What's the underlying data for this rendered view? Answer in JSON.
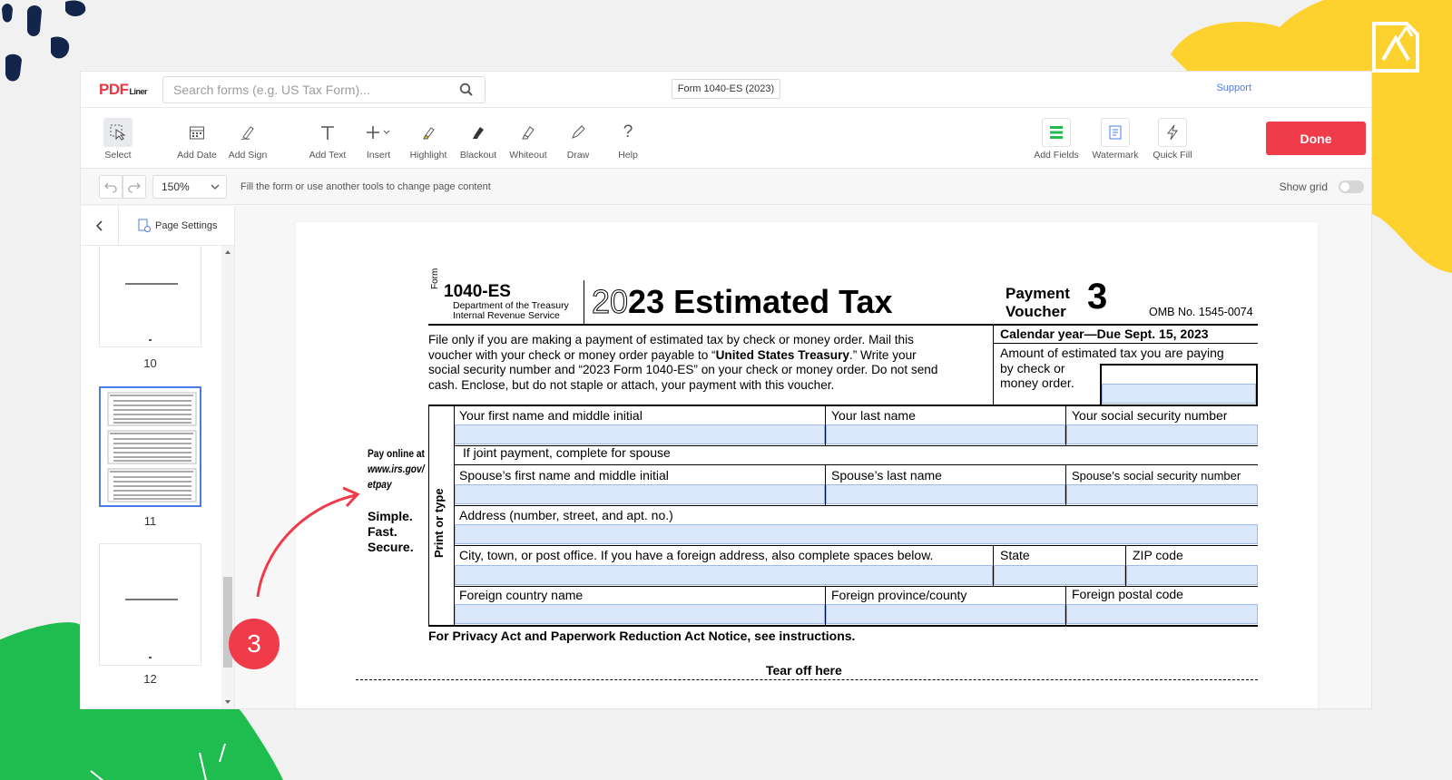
{
  "app": {
    "logo": "PDF",
    "logo_suffix": "Liner",
    "search_placeholder": "Search forms (e.g. US Tax Form)...",
    "doc_title": "Form 1040-ES (2023)",
    "support": "Support"
  },
  "toolbar": {
    "tools": [
      {
        "label": "Select",
        "icon": "select-cursor-icon"
      },
      {
        "label": "Add Date",
        "icon": "calendar-icon"
      },
      {
        "label": "Add Sign",
        "icon": "sign-pen-icon"
      },
      {
        "label": "Add Text",
        "icon": "text-icon"
      },
      {
        "label": "Insert",
        "icon": "plus-icon"
      },
      {
        "label": "Highlight",
        "icon": "highlighter-icon"
      },
      {
        "label": "Blackout",
        "icon": "blackout-icon"
      },
      {
        "label": "Whiteout",
        "icon": "whiteout-icon"
      },
      {
        "label": "Draw",
        "icon": "draw-pen-icon"
      },
      {
        "label": "Help",
        "icon": "help-icon"
      }
    ],
    "right_tools": [
      {
        "label": "Add Fields",
        "icon": "fields-icon"
      },
      {
        "label": "Watermark",
        "icon": "watermark-icon"
      },
      {
        "label": "Quick Fill",
        "icon": "lightning-icon"
      }
    ],
    "done": "Done"
  },
  "subbar": {
    "zoom": "150%",
    "hint": "Fill the form or use another tools to change page content",
    "show_grid": "Show grid"
  },
  "sidebar": {
    "page_settings": "Page Settings",
    "pages": [
      "10",
      "11",
      "12"
    ],
    "selected_page": "11"
  },
  "form": {
    "form_word": "Form",
    "form_number": "1040-ES",
    "dept": "Department of the Treasury",
    "irs": "Internal Revenue Service",
    "title_year_light": "20",
    "title_year_bold": "23",
    "title_text": "Estimated Tax",
    "payment": "Payment",
    "voucher": "Voucher",
    "voucher_num": "3",
    "omb": "OMB No. 1545-0074",
    "calendar_year": "Calendar year—Due Sept. 15, 2023",
    "instr_line1": "File only if you are making a payment of estimated tax by check or money order. Mail this",
    "instr_line2a": "voucher with your check or money order payable to “",
    "instr_line2b": "United States Treasury",
    "instr_line2c": ".” Write your",
    "instr_line3": "social security number and “2023 Form 1040-ES” on your check or money order. Do not send",
    "instr_line4": "cash. Enclose, but do not staple or attach, your payment with this voucher.",
    "amount_line1": "Amount of estimated tax you are paying",
    "amount_line2": "by check or",
    "amount_line3": "money order.",
    "pay_online1": "Pay online at",
    "pay_online2": "www.irs.gov/",
    "pay_online3": "etpay",
    "simple": "Simple.",
    "fast": "Fast.",
    "secure": "Secure.",
    "print_or_type": "Print or type",
    "first_name": "Your first name and middle initial",
    "last_name": "Your last name",
    "ssn": "Your social security number",
    "joint": "If joint payment, complete for spouse",
    "spouse_first": "Spouse’s first name and middle initial",
    "spouse_last": "Spouse’s last name",
    "spouse_ssn": "Spouse’s social security number",
    "address": "Address (number, street, and apt. no.)",
    "city": "City, town, or post office. If you have a foreign address, also complete spaces below.",
    "state": "State",
    "zip": "ZIP code",
    "foreign_country": "Foreign country name",
    "foreign_province": "Foreign province/county",
    "foreign_postal": "Foreign postal code",
    "privacy": "For Privacy Act and Paperwork Reduction Act Notice, see instructions.",
    "tear": "Tear off here"
  },
  "annotation": {
    "step": "3"
  },
  "colors": {
    "brand_red": "#ef3b4a",
    "field_blue": "#dbe7fb",
    "accent_blue": "#4a7be6",
    "deco_yellow": "#fdd22f",
    "deco_green": "#1fbc4f",
    "deco_navy": "#13254a"
  }
}
